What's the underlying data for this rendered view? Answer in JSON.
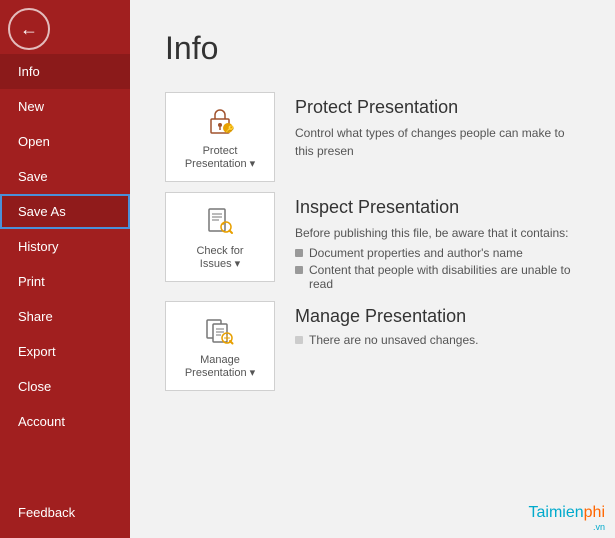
{
  "sidebar": {
    "back_icon": "←",
    "items": [
      {
        "id": "info",
        "label": "Info",
        "active": true
      },
      {
        "id": "new",
        "label": "New"
      },
      {
        "id": "open",
        "label": "Open"
      },
      {
        "id": "save",
        "label": "Save"
      },
      {
        "id": "save-as",
        "label": "Save As",
        "highlighted": true
      },
      {
        "id": "history",
        "label": "History"
      },
      {
        "id": "print",
        "label": "Print"
      },
      {
        "id": "share",
        "label": "Share"
      },
      {
        "id": "export",
        "label": "Export"
      },
      {
        "id": "close",
        "label": "Close"
      },
      {
        "id": "account",
        "label": "Account"
      }
    ],
    "feedback_label": "Feedback"
  },
  "main": {
    "title": "Info",
    "cards": [
      {
        "id": "protect",
        "icon_label": "Protect Presentation ▾",
        "title": "Protect Presentation",
        "description": "Control what types of changes people can make to this presen"
      },
      {
        "id": "inspect",
        "icon_label": "Check for Issues ▾",
        "title": "Inspect Presentation",
        "description_intro": "Before publishing this file, be aware that it contains:",
        "bullets": [
          "Document properties and author's name",
          "Content that people with disabilities are unable to read"
        ]
      },
      {
        "id": "manage",
        "icon_label": "Manage Presentation ▾",
        "title": "Manage Presentation",
        "description": "There are no unsaved changes."
      }
    ]
  },
  "watermark": {
    "text": "Taimienphi",
    "suffix": ".vn"
  }
}
